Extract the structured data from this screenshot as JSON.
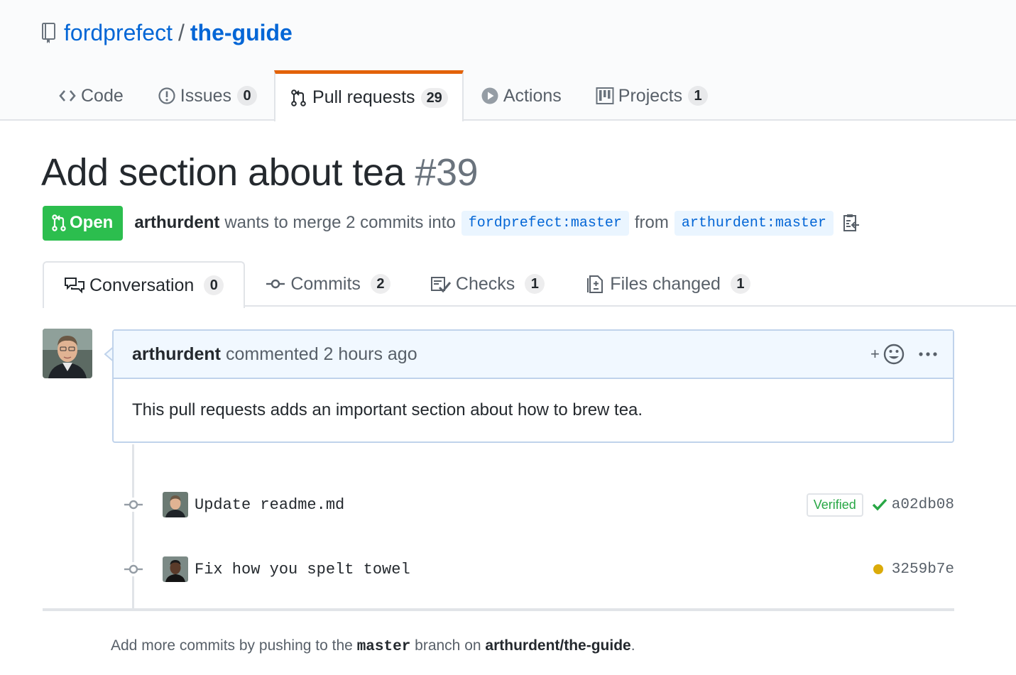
{
  "repo": {
    "owner": "fordprefect",
    "separator": "/",
    "name": "the-guide",
    "icon": "repo-book-icon"
  },
  "reponav": [
    {
      "label": "Code",
      "counter": null,
      "icon": "code-icon"
    },
    {
      "label": "Issues",
      "counter": "0",
      "icon": "issue-icon"
    },
    {
      "label": "Pull requests",
      "counter": "29",
      "icon": "pull-request-icon",
      "selected": true
    },
    {
      "label": "Actions",
      "counter": null,
      "icon": "play-icon"
    },
    {
      "label": "Projects",
      "counter": "1",
      "icon": "project-icon"
    }
  ],
  "pr": {
    "title": "Add section about tea",
    "number": "#39",
    "state": "Open",
    "author": "arthurdent",
    "merge_text": "wants to merge 2 commits into",
    "base_branch": "fordprefect:master",
    "from_text": "from",
    "head_branch": "arthurdent:master"
  },
  "tabs": [
    {
      "label": "Conversation",
      "counter": "0",
      "icon": "comment-discussion-icon",
      "selected": true
    },
    {
      "label": "Commits",
      "counter": "2",
      "icon": "git-commit-icon"
    },
    {
      "label": "Checks",
      "counter": "1",
      "icon": "checklist-icon"
    },
    {
      "label": "Files changed",
      "counter": "1",
      "icon": "file-diff-icon"
    }
  ],
  "comment": {
    "author": "arthurdent",
    "meta": "commented 2 hours ago",
    "body": "This pull requests adds an important section about how to brew tea.",
    "reaction_button": "+"
  },
  "commits": [
    {
      "message": "Update readme.md",
      "verified": "Verified",
      "status": "success",
      "sha": "a02db08"
    },
    {
      "message": "Fix how you spelt towel",
      "verified": null,
      "status": "pending",
      "sha": "3259b7e"
    }
  ],
  "footer": {
    "prefix": "Add more commits by pushing to the",
    "branch": "master",
    "middle": "branch on",
    "repo": "arthurdent/the-guide",
    "suffix": "."
  },
  "colors": {
    "link": "#0366d6",
    "open_green": "#2cbe4e",
    "selected_tab_accent": "#e36209",
    "pending": "#dbab09",
    "success": "#28a745"
  }
}
